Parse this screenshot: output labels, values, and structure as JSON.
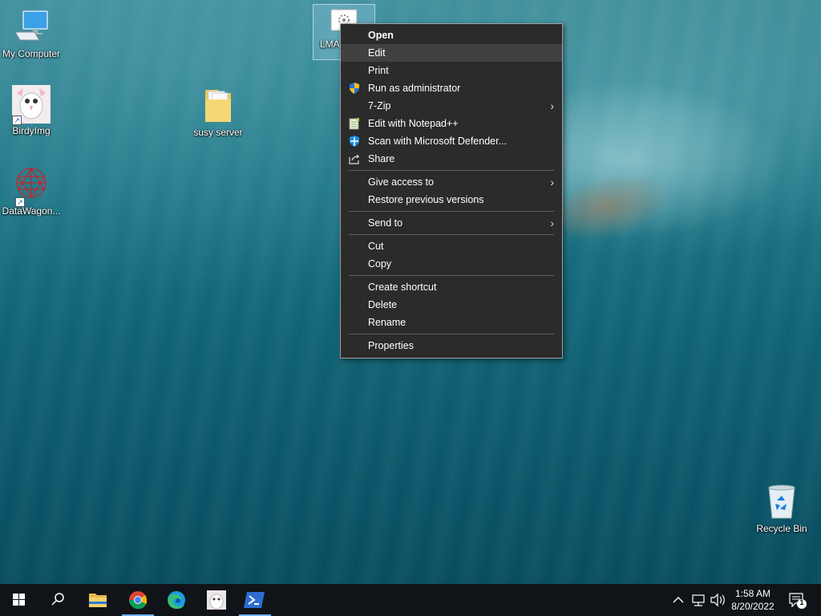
{
  "desktop": {
    "icons": [
      {
        "label": "My Computer",
        "icon": "computer-icon"
      },
      {
        "label": "BirdyImg",
        "icon": "image-shortcut-icon"
      },
      {
        "label": "susy server",
        "icon": "folder-icon"
      },
      {
        "label": "DataWagon...",
        "icon": "app-shortcut-icon"
      },
      {
        "label": "LMA",
        "icon": "settings-file-icon"
      },
      {
        "label": "Recycle Bin",
        "icon": "recycle-bin-icon"
      }
    ]
  },
  "context_menu": {
    "items": {
      "open": "Open",
      "edit": "Edit",
      "print": "Print",
      "run_as_admin": "Run as administrator",
      "seven_zip": "7-Zip",
      "edit_notepad": "Edit with Notepad++",
      "scan_defender": "Scan with Microsoft Defender...",
      "share": "Share",
      "give_access": "Give access to",
      "restore_versions": "Restore previous versions",
      "send_to": "Send to",
      "cut": "Cut",
      "copy": "Copy",
      "create_shortcut": "Create shortcut",
      "delete": "Delete",
      "rename": "Rename",
      "properties": "Properties"
    },
    "submenu_arrow": "›"
  },
  "taskbar": {
    "clock_time": "1:58 AM",
    "clock_date": "8/20/2022",
    "notification_count": "1",
    "tray_chevron": "^",
    "accent": "#6fb1ff"
  }
}
